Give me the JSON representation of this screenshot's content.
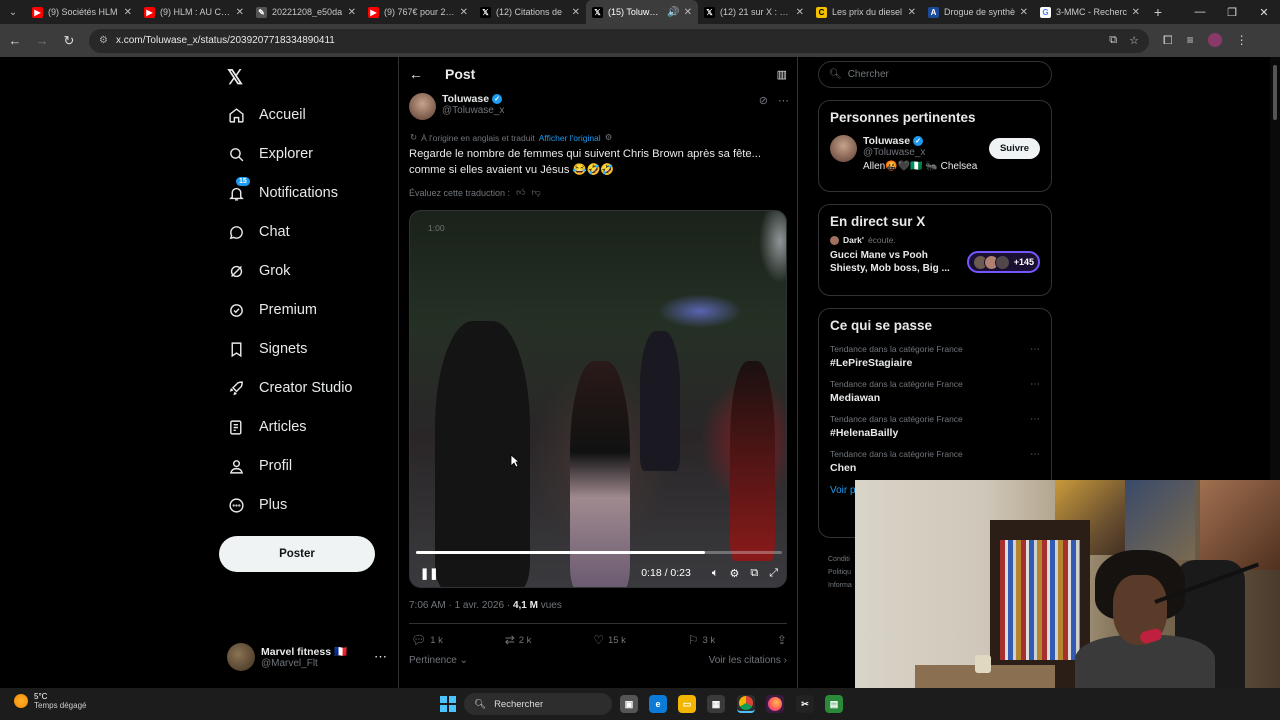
{
  "browser": {
    "tabs": [
      {
        "label": "(9) Sociétés HLM",
        "favicon": "youtube-icon",
        "color": "#ff0000",
        "active": false
      },
      {
        "label": "(9) HLM : AU CŒUR",
        "favicon": "youtube-icon",
        "color": "#ff0000",
        "active": false
      },
      {
        "label": "20221208_e50da",
        "favicon": "quill-icon",
        "color": "#555555",
        "active": false
      },
      {
        "label": "(9) 767€ pour 27m",
        "favicon": "youtube-icon",
        "color": "#ff0000",
        "active": false
      },
      {
        "label": "(12) Citations de",
        "favicon": "x-icon",
        "color": "#000000",
        "active": false
      },
      {
        "label": "(15) Toluwase",
        "favicon": "x-icon",
        "color": "#000000",
        "active": true
      },
      {
        "label": "(12) 21 sur X : \"Ky",
        "favicon": "x-icon",
        "color": "#000000",
        "active": false
      },
      {
        "label": "Les prix du diesel",
        "favicon": "c-icon",
        "color": "#f2c200",
        "active": false
      },
      {
        "label": "Drogue de synthè",
        "favicon": "a-icon",
        "color": "#1a4a9a",
        "active": false
      },
      {
        "label": "3-MMC - Recherc",
        "favicon": "google-icon",
        "color": "#ffffff",
        "active": false
      }
    ],
    "url": "x.com/Toluwase_x/status/2039207718334890411"
  },
  "nav": {
    "items": [
      {
        "label": "Accueil",
        "icon": "home-icon"
      },
      {
        "label": "Explorer",
        "icon": "search-icon"
      },
      {
        "label": "Notifications",
        "icon": "bell-icon",
        "badge": "15"
      },
      {
        "label": "Chat",
        "icon": "chat-icon"
      },
      {
        "label": "Grok",
        "icon": "grok-icon"
      },
      {
        "label": "Premium",
        "icon": "verified-badge-icon"
      },
      {
        "label": "Signets",
        "icon": "bookmark-icon"
      },
      {
        "label": "Creator Studio",
        "icon": "rocket-icon"
      },
      {
        "label": "Articles",
        "icon": "article-icon"
      },
      {
        "label": "Profil",
        "icon": "person-icon"
      },
      {
        "label": "Plus",
        "icon": "more-circle-icon"
      }
    ],
    "post_button": "Poster",
    "account": {
      "name": "Marvel fitness 🇫🇷",
      "handle": "@Marvel_Flt"
    }
  },
  "post": {
    "header_title": "Post",
    "author_name": "Toluwase",
    "author_handle": "@Toluwase_x",
    "translated_note": "À l'origine en anglais et traduit",
    "show_original": "Afficher l'original",
    "text": "Regarde le nombre de femmes qui suivent Chris Brown après sa fête... comme si elles avaient vu Jésus 😂🤣🤣",
    "rate_translation": "Évaluez cette traduction :",
    "video": {
      "corner_time": "1:00",
      "current_time": "0:18 / 0:23",
      "progress": 0.79
    },
    "timestamp": "7:06 AM · 1 avr. 2026 · ",
    "views_count": "4,1 M",
    "views_label": " vues",
    "stats": {
      "replies": "1 k",
      "reposts": "2 k",
      "likes": "15 k",
      "bookmarks": "3 k"
    },
    "sort_label": "Pertinence",
    "quotes_link": "Voir les citations"
  },
  "sidebar": {
    "search_placeholder": "Chercher",
    "relevant_title": "Personnes pertinentes",
    "relevant_user": {
      "name": "Toluwase",
      "handle": "@Toluwase_x",
      "bio": "Allen🤬🖤🇳🇬 🐜 Chelsea",
      "follow": "Suivre"
    },
    "live_title": "En direct sur X",
    "live_host": "Dark'",
    "live_host_suffix": "écoute.",
    "live_stream_title": "Gucci Mane vs Pooh Shiesty, Mob boss, Big ...",
    "live_count": "+145",
    "trends_title": "Ce qui se passe",
    "trends": [
      {
        "category": "Tendance dans la catégorie France",
        "topic": "#LePireStagiaire"
      },
      {
        "category": "Tendance dans la catégorie France",
        "topic": "Mediawan"
      },
      {
        "category": "Tendance dans la catégorie France",
        "topic": "#HelenaBailly"
      },
      {
        "category": "Tendance dans la catégorie France",
        "topic": "Chen"
      }
    ],
    "see_more": "Voir p",
    "footer_links": [
      "Conditi",
      "Politiqu",
      "Informa"
    ]
  },
  "taskbar": {
    "temp": "5°C",
    "weather": "Temps dégagé",
    "search": "Rechercher"
  },
  "colors": {
    "accent": "#1d9bf0",
    "background": "#000000",
    "border": "#2f3336"
  }
}
